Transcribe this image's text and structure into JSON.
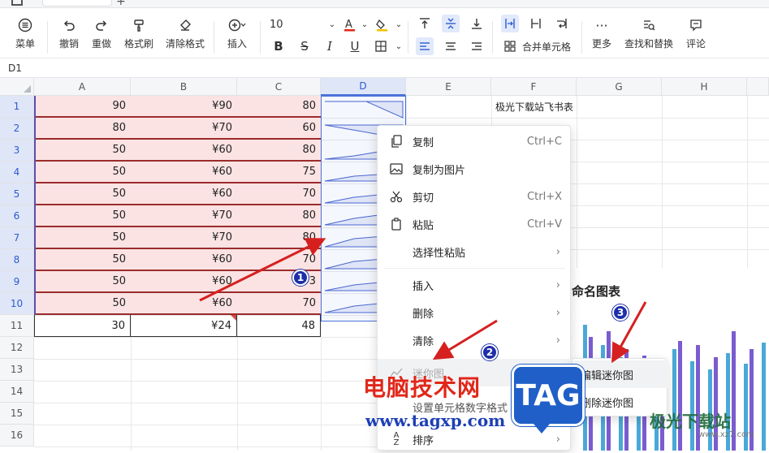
{
  "toolbar": {
    "menu": "菜单",
    "undo": "撤销",
    "redo": "重做",
    "format_painter": "格式刷",
    "clear_format": "清除格式",
    "insert": "插入",
    "font_size": "10",
    "merge_cells": "合并单元格",
    "more": "更多",
    "find_replace": "查找和替换",
    "comment": "评论"
  },
  "formula_bar": {
    "cell_ref": "D1"
  },
  "columns": [
    "A",
    "B",
    "C",
    "D",
    "E",
    "F",
    "G",
    "H"
  ],
  "rows": [
    "1",
    "2",
    "3",
    "4",
    "5",
    "6",
    "7",
    "8",
    "9",
    "10",
    "11",
    "12",
    "13",
    "14",
    "15",
    "16"
  ],
  "table": [
    [
      "90",
      "¥90",
      "80"
    ],
    [
      "80",
      "¥70",
      "60"
    ],
    [
      "50",
      "¥60",
      "80"
    ],
    [
      "50",
      "¥60",
      "75"
    ],
    [
      "50",
      "¥60",
      "70"
    ],
    [
      "50",
      "¥70",
      "80"
    ],
    [
      "50",
      "¥70",
      "80"
    ],
    [
      "50",
      "¥60",
      "70"
    ],
    [
      "50",
      "¥60",
      "73"
    ],
    [
      "50",
      "¥60",
      "70"
    ],
    [
      "30",
      "¥24",
      "48"
    ]
  ],
  "f1_text": "极光下载站飞书表",
  "context_menu": {
    "copy": "复制",
    "copy_shortcut": "Ctrl+C",
    "copy_as_image": "复制为图片",
    "cut": "剪切",
    "cut_shortcut": "Ctrl+X",
    "paste": "粘贴",
    "paste_shortcut": "Ctrl+V",
    "paste_special": "选择性粘贴",
    "insert": "插入",
    "delete": "删除",
    "clear": "清除",
    "sparkline": "迷你图",
    "set_number_format": "设置单元格数字格式",
    "sort": "排序"
  },
  "submenu": {
    "edit_sparkline": "编辑迷你图",
    "delete_sparkline": "删除迷你图"
  },
  "chart": {
    "title": "命名图表"
  },
  "annotations": {
    "b1": "1",
    "b2": "2",
    "b3": "3"
  },
  "watermark": {
    "title": "电脑技术网",
    "url": "www.tagxp.com",
    "tag": "TAG",
    "logo": "极光下载站",
    "logo_url": "www.xz7.com"
  },
  "colors": {
    "accent": "#4a72d8",
    "pink_fill": "#fbe3e3",
    "row_border": "#9b2c2c",
    "arrow": "#d62020",
    "badge": "#1d2fa8"
  }
}
